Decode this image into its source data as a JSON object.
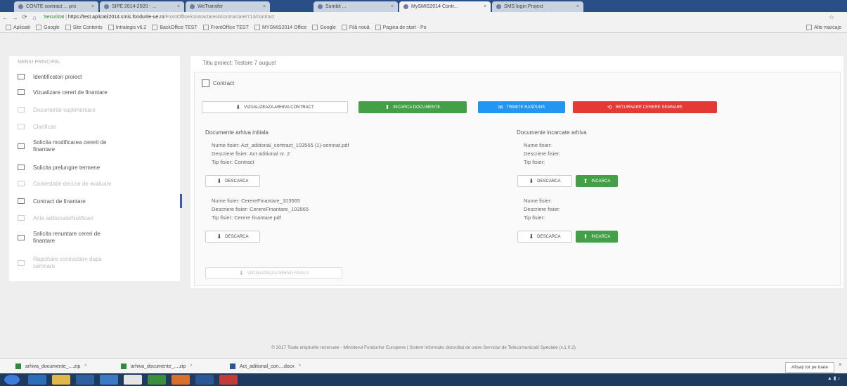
{
  "browser": {
    "tabs": [
      {
        "label": "CONTE contract ... pro"
      },
      {
        "label": "SIPE 2014-2020 - ..."
      },
      {
        "label": "WeTransfer"
      },
      {
        "label": "Sumbit ..."
      },
      {
        "label": "MySMIS2014 Contr..."
      },
      {
        "label": "SMS login Project"
      }
    ],
    "url_secure": "Securizat",
    "url_host": "https://test.aplicatii2014.smis.fondurile-ue.ro",
    "url_path": "/FrontOffice/contractare/4/contractare/713/contract",
    "bookmarks": [
      "Aplicatii",
      "Google",
      "Site Contents",
      "Intralegis v6.2",
      "BackOffice TEST",
      "FrontOffice TEST",
      "MYSMIS2014 Office",
      "Google",
      "Filă nouă",
      "Pagina de start - Po"
    ],
    "other_bookmarks": "Alte marcaje"
  },
  "sidebar": {
    "header": "MENIU PRINCIPAL",
    "items": [
      {
        "label": "Identificaton proiect",
        "icon": "folder-icon",
        "state": "normal"
      },
      {
        "label": "Vizualizare cereri de finantare",
        "icon": "grid-icon",
        "state": "normal"
      },
      {
        "label": "Documente suplimentare",
        "icon": "file-icon",
        "state": "disabled"
      },
      {
        "label": "Clarificari",
        "icon": "pen-icon",
        "state": "disabled"
      },
      {
        "label": "Solicita modificarea cererii de finantare",
        "icon": "edit-icon",
        "state": "normal"
      },
      {
        "label": "Solicita prelungire termene",
        "icon": "calendar-icon",
        "state": "normal"
      },
      {
        "label": "Contestatie decizie de evaluare",
        "icon": "file-icon",
        "state": "disabled"
      },
      {
        "label": "Contract de finantare",
        "icon": "contract-icon",
        "state": "active"
      },
      {
        "label": "Acte aditionale/Notificari",
        "icon": "file-icon",
        "state": "disabled"
      },
      {
        "label": "Solicita renuntare cereri de finantare",
        "icon": "link-icon",
        "state": "normal"
      },
      {
        "label": "Raportare contractare dupa semnare",
        "icon": "list-icon",
        "state": "disabled"
      }
    ]
  },
  "main": {
    "project_title": "Titlu proiect: Testare 7 august",
    "section_title": "Contract",
    "buttons": {
      "view_contract": "VIZUALIZEAZA ARHIVA CONTRACT",
      "upload_docs": "INCARCA DOCUMENTE",
      "send_response": "TRIMITE RASPUNS",
      "return_sign": "RETURNARE CERERE SEMNARE"
    },
    "left_column_title": "Documente arhiva initiala",
    "right_column_title": "Documente incarcate arhiva",
    "left_docs": [
      {
        "name": "Nume fisier: Act_aditional_contract_103565 (1)-semnat.pdf",
        "desc": "Descriere fisier: Act aditional nr. 2",
        "type": "Tip fisier: Contract"
      },
      {
        "name": "Nume fisier: CerereFinantare_103565",
        "desc": "Descriere fisier: CerereFinantare_103565",
        "type": "Tip fisier: Cerere finantare pdf"
      }
    ],
    "right_docs": [
      {
        "name": "Nume fisier:",
        "desc": "Descriere fisier:",
        "type": "Tip fisier:"
      },
      {
        "name": "Nume fisier:",
        "desc": "Descriere fisier:",
        "type": "Tip fisier:"
      }
    ],
    "download_label": "DESCARCA",
    "upload_label": "INCARCA",
    "final_archive": "VIZUALIZEAZA ARHIVA FINALA"
  },
  "footer": "© 2017 Toate drepturile rezervate - Ministerul Fondurilor Europene | Sistem informatic dezvoltat de catre Serviciul de Telecomunicatii Speciale (v.1.0.2)",
  "downloads": {
    "items": [
      "arhiva_documente_....zip",
      "arhiva_documente_....zip",
      "Act_aditional_con....docx"
    ],
    "show_all": "Afișați tot pe toate"
  },
  "colors": {
    "green": "#43a047",
    "blue": "#2196f3",
    "red": "#e53935",
    "active_marker": "#3b5ba9"
  }
}
